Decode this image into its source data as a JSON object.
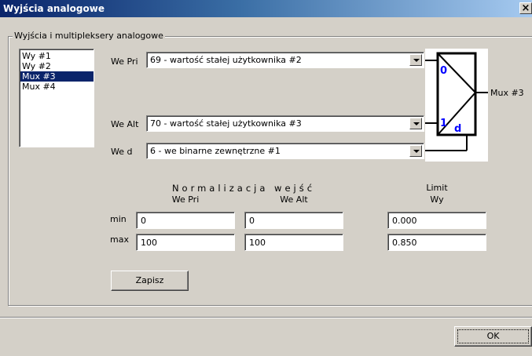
{
  "window": {
    "title": "Wyjścia analogowe",
    "close_glyph": "×"
  },
  "group": {
    "label": "Wyjścia i multipleksery analogowe"
  },
  "outputs_list": {
    "items": [
      "Wy #1",
      "Wy #2",
      "Mux #3",
      "Mux #4"
    ],
    "selected": "Mux #3"
  },
  "inputs": {
    "we_pri": {
      "label": "We Pri",
      "value": "69 - wartość stałej użytkownika #2"
    },
    "we_alt": {
      "label": "We Alt",
      "value": "70 - wartość stałej użytkownika #3"
    },
    "we_d": {
      "label": "We d",
      "value": "6 - we binarne zewnętrzne #1"
    }
  },
  "diagram": {
    "input0": "0",
    "input1": "1",
    "input_d": "d",
    "output_label": "Mux #3",
    "accent_color": "#0000ff"
  },
  "normalization": {
    "title": "Normalizacja wejść",
    "col_pri": "We Pri",
    "col_alt": "We Alt",
    "limit_title": "Limit",
    "limit_col": "Wy",
    "row_min": "min",
    "row_max": "max",
    "min_pri": "0",
    "min_alt": "0",
    "min_limit": "0.000",
    "max_pri": "100",
    "max_alt": "100",
    "max_limit": "0.850"
  },
  "buttons": {
    "save": "Zapisz",
    "ok": "OK"
  },
  "colors": {
    "titlebar_start": "#0a246a",
    "titlebar_end": "#a6caf0",
    "selection": "#0a246a",
    "face": "#d4d0c8"
  }
}
